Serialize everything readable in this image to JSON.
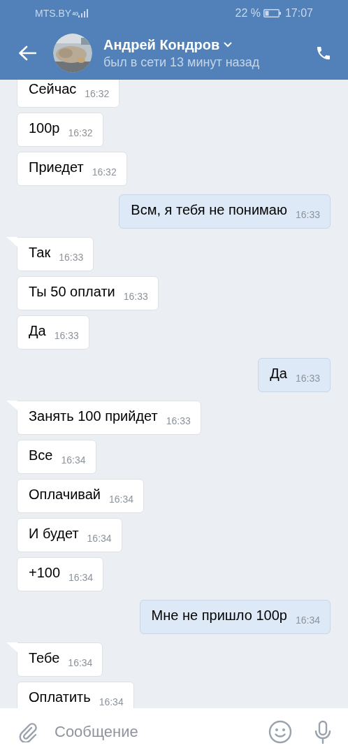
{
  "status_bar": {
    "carrier": "MTS.BY",
    "network": "4G",
    "battery_percent": "22 %",
    "time": "17:07"
  },
  "header": {
    "name": "Андрей Кондров",
    "status": "был в сети 13 минут назад"
  },
  "messages": [
    {
      "kind": "in",
      "tail": false,
      "text": "Сейчас",
      "time": "16:32"
    },
    {
      "kind": "in",
      "tail": false,
      "text": "100р",
      "time": "16:32"
    },
    {
      "kind": "in",
      "tail": false,
      "text": "Приедет",
      "time": "16:32"
    },
    {
      "kind": "out",
      "text": "Всм, я тебя не понимаю",
      "time": "16:33"
    },
    {
      "kind": "in",
      "tail": true,
      "text": "Так",
      "time": "16:33"
    },
    {
      "kind": "in",
      "tail": false,
      "text": "Ты 50 оплати",
      "time": "16:33"
    },
    {
      "kind": "in",
      "tail": false,
      "text": "Да",
      "time": "16:33"
    },
    {
      "kind": "out",
      "text": "Да",
      "time": "16:33"
    },
    {
      "kind": "in",
      "tail": true,
      "text": "Занять 100 прийдет",
      "time": "16:33"
    },
    {
      "kind": "in",
      "tail": false,
      "text": "Все",
      "time": "16:34"
    },
    {
      "kind": "in",
      "tail": false,
      "text": "Оплачивай",
      "time": "16:34"
    },
    {
      "kind": "in",
      "tail": false,
      "text": "И будет",
      "time": "16:34"
    },
    {
      "kind": "in",
      "tail": false,
      "text": "+100",
      "time": "16:34"
    },
    {
      "kind": "out",
      "text": "Мне не пришло 100р",
      "time": "16:34"
    },
    {
      "kind": "in",
      "tail": true,
      "text": "Тебе",
      "time": "16:34"
    },
    {
      "kind": "in",
      "tail": false,
      "text": "Оплатить",
      "time": "16:34"
    }
  ],
  "composer": {
    "placeholder": "Сообщение"
  }
}
